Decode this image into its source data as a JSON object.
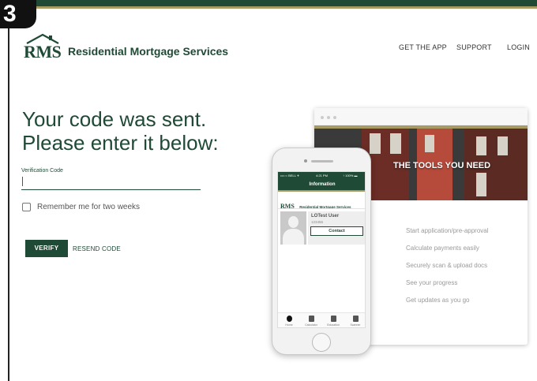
{
  "step_badge": "3",
  "logo": {
    "abbr": "RMS",
    "name": "Residential Mortgage Services"
  },
  "nav": {
    "items": [
      "GET THE APP",
      "SUPPORT",
      "LOGIN"
    ]
  },
  "form": {
    "headline_line1": "Your code was sent.",
    "headline_line2": "Please enter it below:",
    "field_label": "Verification Code",
    "field_value": "",
    "remember_label": "Remember me for two weeks",
    "remember_checked": false,
    "verify_label": "VERIFY",
    "resend_label": "RESEND CODE"
  },
  "promo": {
    "hero_title": "THE TOOLS YOU NEED",
    "features": [
      "Start application/pre-approval",
      "Calculate payments easily",
      "Securely scan & upload docs",
      "See your progress",
      "Get updates as you go"
    ]
  },
  "phone_app": {
    "status_left": "•••○○ BELL ✈",
    "status_time": "4:21 PM",
    "status_right": "↑ 100% ▬",
    "header_title": "Information",
    "logo_abbr": "RMS",
    "logo_name": "Residential Mortgage Services",
    "user_name": "LOTest User",
    "user_id": "123456",
    "contact_label": "Contact",
    "tabs": [
      "Home",
      "Calculator",
      "Education",
      "Scanner"
    ]
  },
  "colors": {
    "brand_green": "#1f4a36",
    "brand_gold": "#a79a63"
  }
}
